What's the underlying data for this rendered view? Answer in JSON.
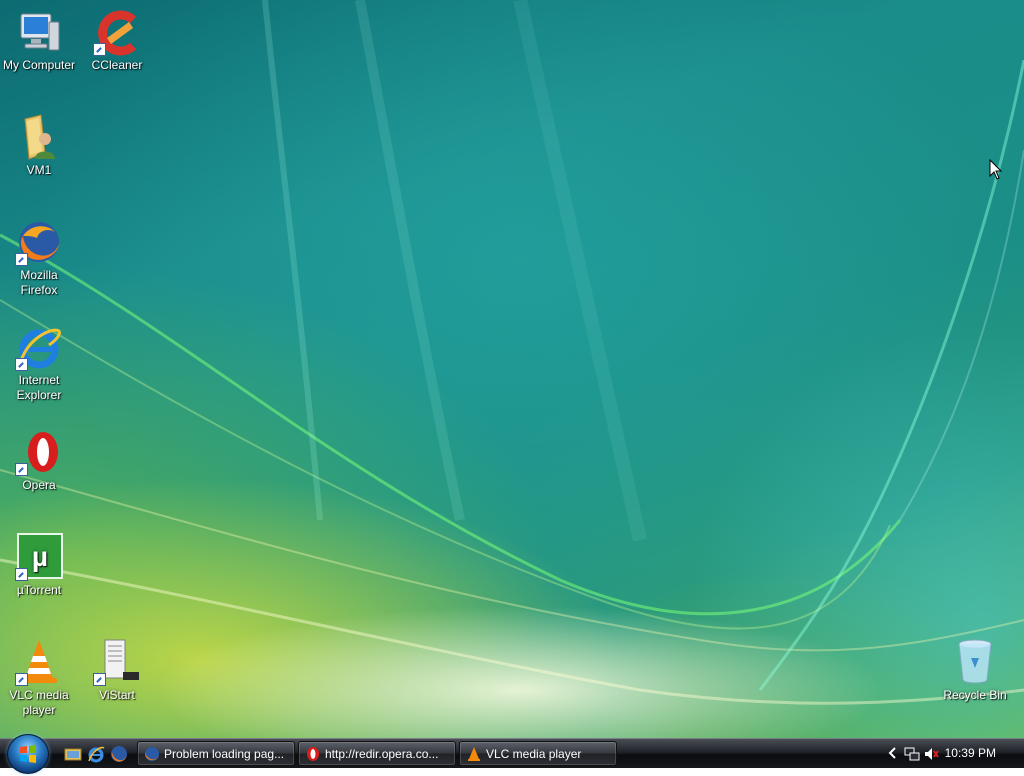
{
  "desktop": {
    "icons": [
      {
        "label": "My Computer",
        "icon": "computer-icon"
      },
      {
        "label": "CCleaner",
        "icon": "ccleaner-icon"
      },
      {
        "label": "VM1",
        "icon": "user-folder-icon"
      },
      {
        "label": "Mozilla Firefox",
        "icon": "firefox-icon"
      },
      {
        "label": "Internet Explorer",
        "icon": "internet-explorer-icon"
      },
      {
        "label": "Opera",
        "icon": "opera-icon"
      },
      {
        "label": "µTorrent",
        "icon": "utorrent-icon"
      },
      {
        "label": "VLC media player",
        "icon": "vlc-icon"
      },
      {
        "label": "ViStart",
        "icon": "vistart-icon"
      },
      {
        "label": "Recycle Bin",
        "icon": "recycle-bin-icon"
      }
    ]
  },
  "taskbar": {
    "quick_launch": [
      "show-desktop-icon",
      "internet-explorer-icon",
      "firefox-icon"
    ],
    "tasks": [
      {
        "label": "Problem loading pag...",
        "icon": "firefox-icon"
      },
      {
        "label": "http://redir.opera.co...",
        "icon": "opera-icon"
      },
      {
        "label": "VLC media player",
        "icon": "vlc-icon"
      }
    ],
    "tray": {
      "icons": [
        "show-hidden-icons-arrow-icon",
        "network-icon",
        "volume-muted-icon"
      ],
      "clock": "10:39 PM"
    }
  },
  "colors": {
    "taskbar": "#15171b",
    "desktop_teal": "#1b8f86",
    "desktop_yellow": "#d6dc3c"
  }
}
